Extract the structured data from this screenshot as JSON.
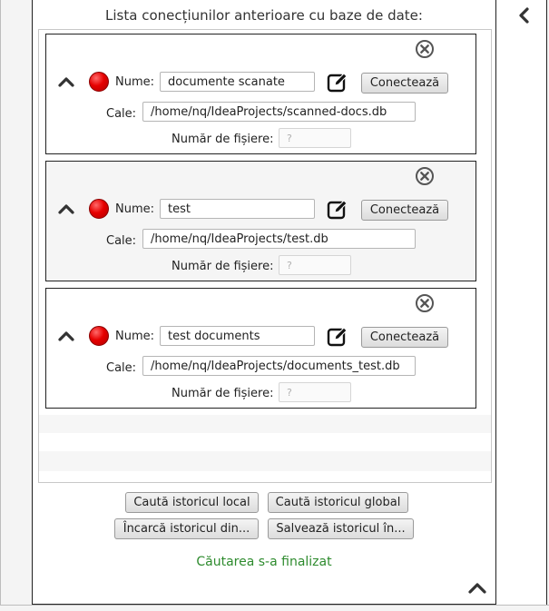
{
  "panel": {
    "title": "Lista conecțiunilor anterioare cu baze de date:"
  },
  "connections": [
    {
      "name_label": "Nume:",
      "name_value": "documente scanate",
      "path_label": "Cale:",
      "path_value": "/home/nq/IdeaProjects/scanned-docs.db",
      "count_label": "Număr de fișiere:",
      "count_placeholder": "?",
      "connect_label": "Conectează",
      "status_color": "#e60000"
    },
    {
      "name_label": "Nume:",
      "name_value": "test",
      "path_label": "Cale:",
      "path_value": "/home/nq/IdeaProjects/test.db",
      "count_label": "Număr de fișiere:",
      "count_placeholder": "?",
      "connect_label": "Conectează",
      "status_color": "#e60000"
    },
    {
      "name_label": "Nume:",
      "name_value": "test documents",
      "path_label": "Cale:",
      "path_value": "/home/nq/IdeaProjects/documents_test.db",
      "count_label": "Număr de fișiere:",
      "count_placeholder": "?",
      "connect_label": "Conectează",
      "status_color": "#e60000"
    }
  ],
  "actions": {
    "search_local": "Caută istoricul local",
    "search_global": "Caută istoricul global",
    "load_history": "Încarcă istoricul din...",
    "save_history": "Salvează istoricul în..."
  },
  "status": {
    "message": "Căutarea s-a finalizat",
    "color": "#2e8b2e"
  },
  "icons": {
    "close": "close-circle-icon",
    "collapse": "chevron-up-icon",
    "edit": "edit-icon",
    "status": "status-indicator-icon",
    "side_toggle": "chevron-left-icon"
  }
}
